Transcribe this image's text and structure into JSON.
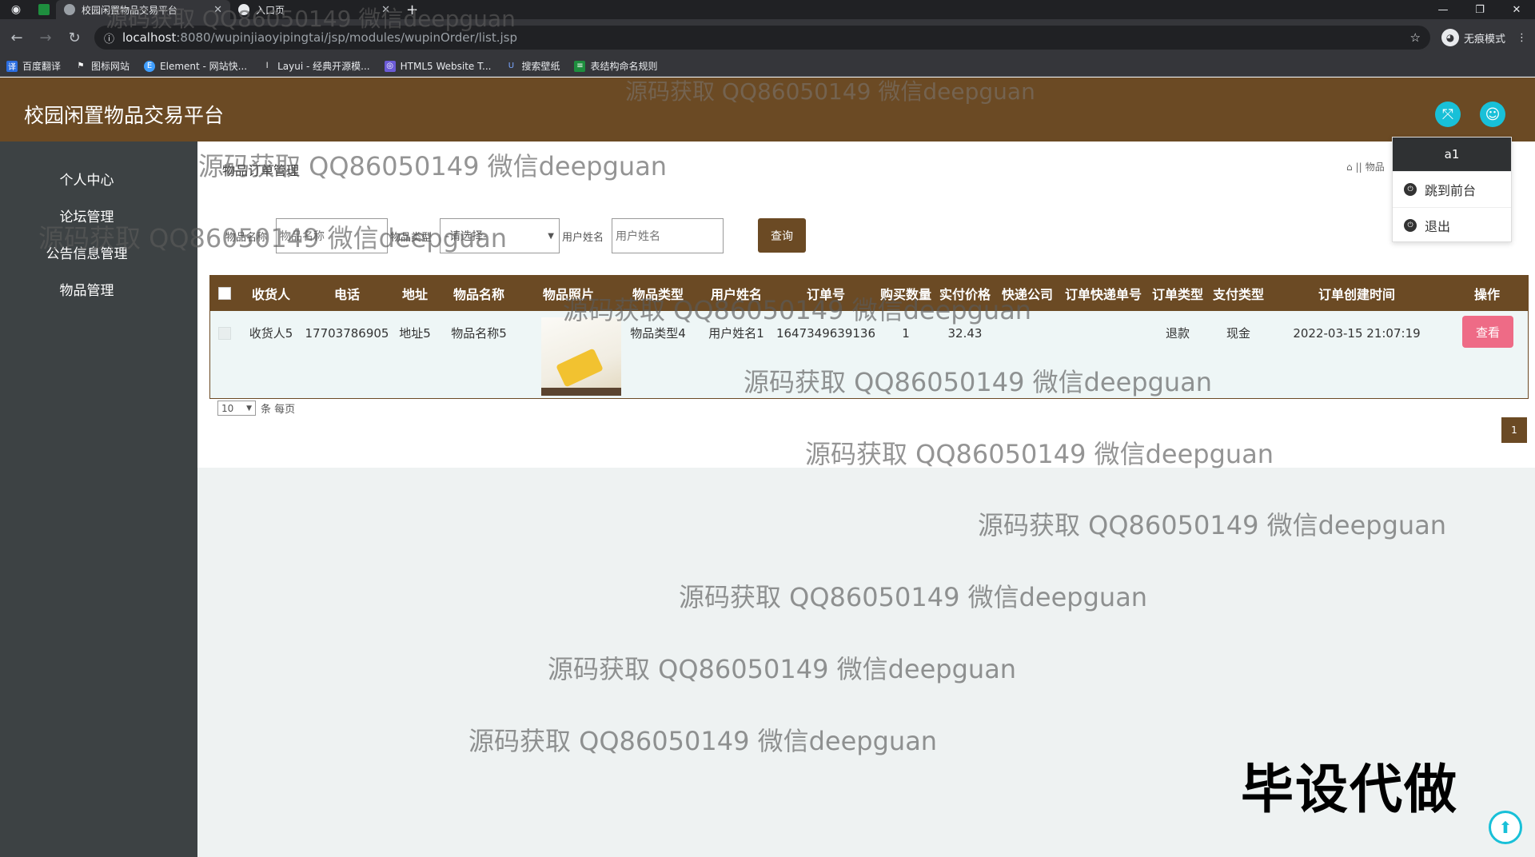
{
  "browser": {
    "tabs": [
      {
        "title": "校园闲置物品交易平台"
      },
      {
        "title": "入口页"
      }
    ],
    "url_host": "localhost",
    "url_path": ":8080/wupinjiaoyipingtai/jsp/modules/wupinOrder/list.jsp",
    "incognito_label": "无痕模式",
    "bookmarks": [
      {
        "label": "百度翻译"
      },
      {
        "label": "图标网站"
      },
      {
        "label": "Element - 网站快..."
      },
      {
        "label": "Layui - 经典开源模..."
      },
      {
        "label": "HTML5 Website T..."
      },
      {
        "label": "搜索壁纸"
      },
      {
        "label": "表结构命名规则"
      }
    ]
  },
  "app": {
    "title": "校园闲置物品交易平台",
    "accent_color": "#6b4a24",
    "sidebar_color": "#3d4244"
  },
  "sidebar": {
    "items": [
      {
        "label": "个人中心"
      },
      {
        "label": "论坛管理"
      },
      {
        "label": "公告信息管理"
      },
      {
        "label": "物品管理"
      }
    ]
  },
  "page": {
    "title": "物品订单管理",
    "breadcrumb": "物品"
  },
  "search": {
    "field1_label": "物品名称",
    "field1_placeholder": "物品名称",
    "field2_label": "物品类型",
    "field2_value": "-请选择-",
    "field3_label": "用户姓名",
    "field3_placeholder": "用户姓名",
    "query_button": "查询"
  },
  "table": {
    "headers": [
      "收货人",
      "电话",
      "地址",
      "物品名称",
      "物品照片",
      "物品类型",
      "用户姓名",
      "订单号",
      "购买数量",
      "实付价格",
      "快递公司",
      "订单快递单号",
      "订单类型",
      "支付类型",
      "订单创建时间",
      "操作"
    ],
    "rows": [
      {
        "receiver": "收货人5",
        "phone": "17703786905",
        "address": "地址5",
        "item_name": "物品名称5",
        "item_type": "物品类型4",
        "user_name": "用户姓名1",
        "order_no": "1647349639136",
        "quantity": "1",
        "price": "32.43",
        "courier": "",
        "tracking_no": "",
        "order_type": "退款",
        "pay_type": "现金",
        "created_at": "2022-03-15 21:07:19",
        "action": "查看"
      }
    ]
  },
  "pager": {
    "page_size": "10",
    "page_size_suffix": "条 每页",
    "current_page": "1"
  },
  "user_menu": {
    "username": "a1",
    "items": [
      {
        "label": "跳到前台"
      },
      {
        "label": "退出"
      }
    ]
  },
  "watermark_text": "源码获取 QQ86050149 微信deepguan",
  "stamp_text": "毕设代做"
}
